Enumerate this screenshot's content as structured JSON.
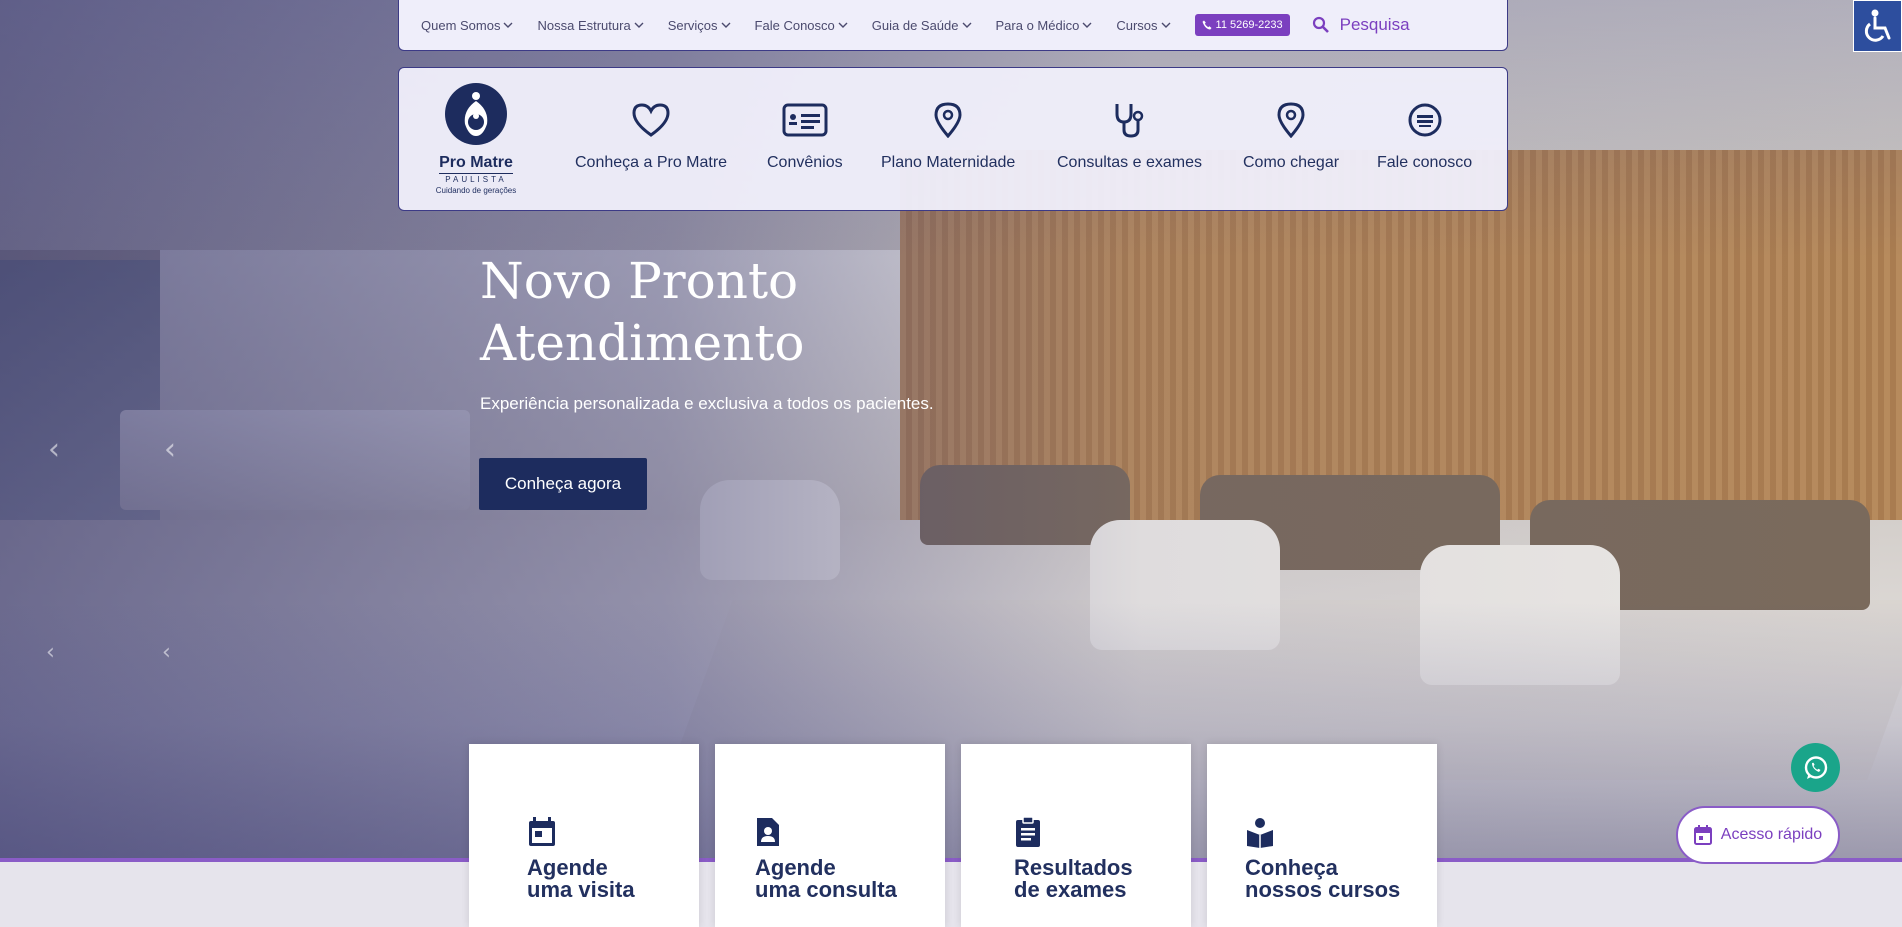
{
  "topbar": {
    "menu": [
      {
        "label": "Quem Somos"
      },
      {
        "label": "Nossa Estrutura"
      },
      {
        "label": "Serviços"
      },
      {
        "label": "Fale Conosco"
      },
      {
        "label": "Guia de Saúde"
      },
      {
        "label": "Para o Médico"
      },
      {
        "label": "Cursos"
      }
    ],
    "phone": "11 5269-2233",
    "search_label": "Pesquisa"
  },
  "logo": {
    "name": "Pro Matre",
    "sub": "PAULISTA",
    "tagline": "Cuidando de gerações"
  },
  "subnav": {
    "items": [
      {
        "label": "Conheça a Pro Matre",
        "icon": "heart-icon"
      },
      {
        "label": "Convênios",
        "icon": "card-icon"
      },
      {
        "label": "Plano Maternidade",
        "icon": "location-pin-icon"
      },
      {
        "label": "Consultas e exames",
        "icon": "stethoscope-icon"
      },
      {
        "label": "Como chegar",
        "icon": "location-pin-icon"
      },
      {
        "label": "Fale conosco",
        "icon": "chat-icon"
      }
    ]
  },
  "hero": {
    "title_line1": "Novo Pronto",
    "title_line2": "Atendimento",
    "subtitle": "Experiência personalizada e exclusiva a todos os pacientes.",
    "cta": "Conheça agora"
  },
  "cards": [
    {
      "line1": "Agende",
      "line2": "uma visita",
      "icon": "calendar-icon"
    },
    {
      "line1": "Agende",
      "line2": "uma consulta",
      "icon": "person-document-icon"
    },
    {
      "line1": "Resultados",
      "line2": "de exames",
      "icon": "clipboard-icon"
    },
    {
      "line1": "Conheça",
      "line2": "nossos cursos",
      "icon": "book-reader-icon"
    }
  ],
  "quick_access": "Acesso rápido",
  "colors": {
    "navy": "#1d2c5e",
    "purple": "#7b3fbf",
    "whatsapp": "#1aa58a",
    "accessibility": "#2d4e9e"
  }
}
